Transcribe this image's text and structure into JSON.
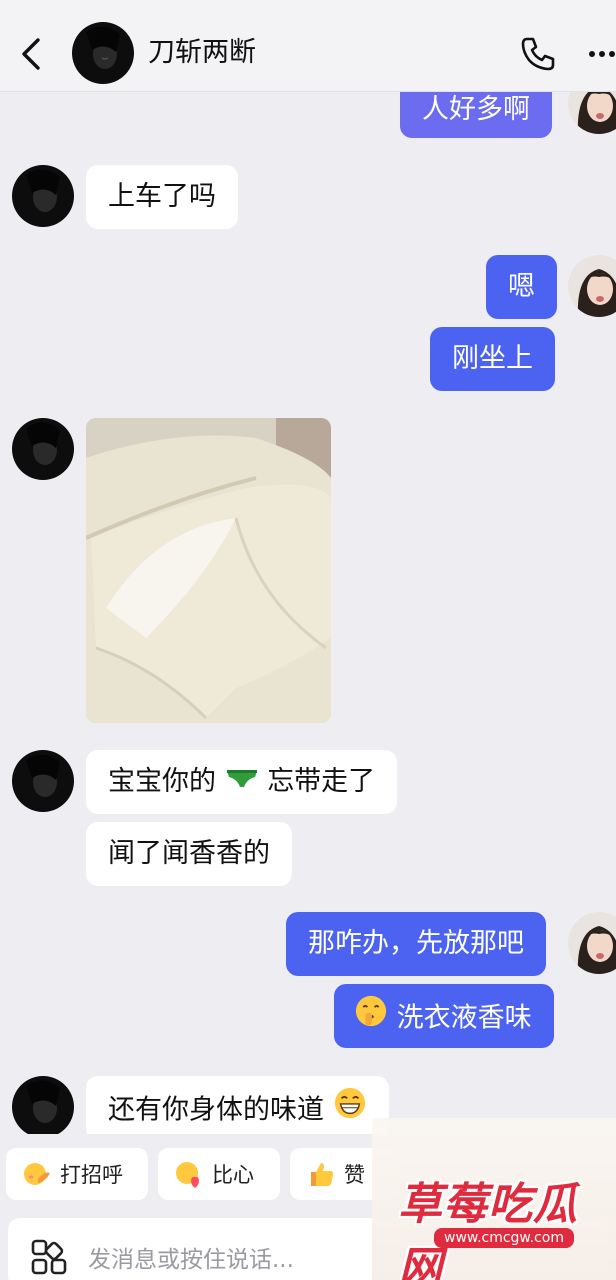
{
  "header": {
    "contact_name": "刀斩两断",
    "back_icon": "chevron-left-icon",
    "call_icon": "phone-icon",
    "more_icon": "more-dots-icon"
  },
  "messages": [
    {
      "side": "right",
      "text": "人好多啊"
    },
    {
      "side": "left",
      "text": "上车了吗"
    },
    {
      "side": "right",
      "text": "嗯"
    },
    {
      "side": "right",
      "text": "刚坐上"
    },
    {
      "side": "left",
      "type": "image"
    },
    {
      "side": "left",
      "text_before": "宝宝你的",
      "emoji": "green-underwear-emoji",
      "text_after": "忘带走了"
    },
    {
      "side": "left",
      "text": "闻了闻香香的"
    },
    {
      "side": "right",
      "text": "那咋办，先放那吧"
    },
    {
      "side": "right",
      "emoji": "shush-face-emoji",
      "text": "洗衣液香味"
    },
    {
      "side": "left",
      "text": "还有你身体的味道",
      "emoji": "grin-emoji"
    }
  ],
  "quick_replies": [
    {
      "label": "打招呼",
      "icon": "wave-hand-icon"
    },
    {
      "label": "比心",
      "icon": "heart-hand-icon"
    },
    {
      "label": "赞",
      "icon": "thumbs-up-icon"
    }
  ],
  "input": {
    "placeholder": "发消息或按住说话..."
  },
  "watermark": {
    "title": "草莓吃瓜网",
    "url": "www.cmcgw.com"
  },
  "colors": {
    "self_bubble": "#4b63f0",
    "other_bubble": "#ffffff",
    "background": "#eeeef2"
  }
}
